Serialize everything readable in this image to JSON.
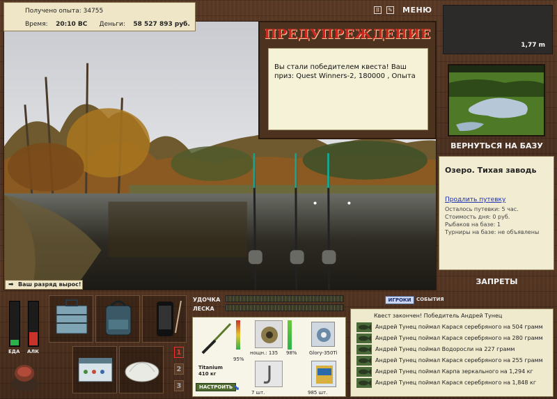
{
  "stats": {
    "experience_label": "Получено опыта:",
    "experience_value": "34755",
    "time_label": "Время:",
    "time_value": "20:10 ВС",
    "money_label": "Деньги:",
    "money_value": "58 527 893 руб."
  },
  "top_controls": {
    "pause_icon": "pause-icon",
    "settings_icon": "settings-icon",
    "menu_label": "МЕНЮ"
  },
  "depth": {
    "value": "1,77 m"
  },
  "warning": {
    "title": "ПРЕДУПРЕЖДЕНИЕ",
    "message": "Вы стали победителем квеста! Ваш приз: Quest Winners-2, 180000 , Опыта"
  },
  "rank_notice": {
    "text": "Ваш разряд вырос!"
  },
  "right_panel": {
    "back_to_base": "ВЕРНУТЬСЯ НА БАЗУ",
    "location_name": "Озеро. Тихая заводь",
    "extend_voucher": "Продлить путевку",
    "info": [
      "Осталось путевки: 5 час.",
      "Стоимость дня: 0 руб.",
      "Рыбаков на базе: 1",
      "Турниры на базе: не объявлены"
    ],
    "bans": "ЗАПРЕТЫ"
  },
  "meters": {
    "food_label": "ЕДА",
    "food_level": 0.12,
    "alcohol_label": "АЛК",
    "alcohol_level": 0.3
  },
  "rod_slots": [
    "1",
    "2",
    "3"
  ],
  "rod_line": {
    "rod_label": "УДОЧКА",
    "line_label": "ЛЕСКА"
  },
  "tackle": {
    "rod_name": "Titanium",
    "rod_weight": "410 кг",
    "rod_percent": "95%",
    "setup_button": "НАСТРОИТЬ",
    "reel_label": "нощн.: 135",
    "reel_percent": "98%",
    "line_name": "Glory-350Ti",
    "hook_count": "7 шт.",
    "bait_count": "985 шт."
  },
  "chat": {
    "tab_players": "ИГРОКИ",
    "tab_events": "СОБЫТИЯ",
    "headline": "Квест закончен! Победитель Андрей Тунец",
    "events": [
      "Андрей Тунец поймал Карася серебряного на 504 грамм",
      "Андрей Тунец поймал Карася серебряного на 280 грамм",
      "Андрей Тунец поймал Водоросли на 227 грамм",
      "Андрей Тунец поймал Карася серебряного на 255 грамм",
      "Андрей Тунец поймал Карпа зеркального на 1,294 кг",
      "Андрей Тунец поймал Карася серебряного на 1,848 кг"
    ]
  },
  "colors": {
    "warning_title": "#c9281e",
    "panel_bg": "#efe6c8",
    "food_meter": "#2cb24a",
    "alcohol_meter": "#c8322a"
  }
}
